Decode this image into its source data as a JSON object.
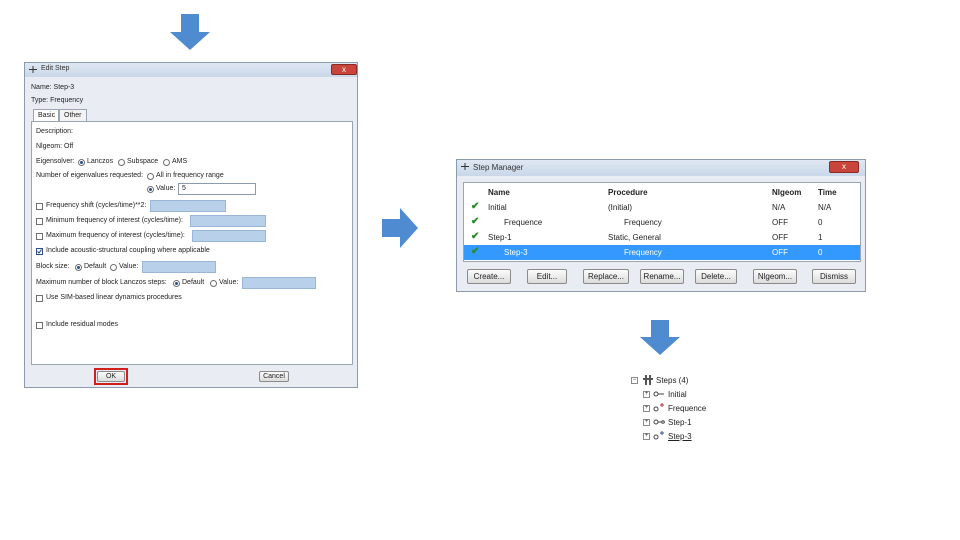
{
  "edit_step": {
    "title": "Edit Step",
    "close": "x",
    "name_line": "Name: Step-3",
    "type_line": "Type: Frequency",
    "tabs": [
      "Basic",
      "Other"
    ],
    "description": "Description:",
    "nlgeom": "Nlgeom: Off",
    "eigensolver_label": "Eigensolver:",
    "eigensolver_options": [
      "Lanczos",
      "Subspace",
      "AMS"
    ],
    "num_eigen_label": "Number of eigenvalues requested:",
    "num_eigen_option_all": "All in frequency range",
    "num_eigen_option_value": "Value:",
    "num_eigen_value": "5",
    "freq_shift": "Frequency shift (cycles/time)**2:",
    "min_freq": "Minimum frequency of interest (cycles/time):",
    "max_freq": "Maximum frequency of interest (cycles/time):",
    "acoustic": "Include acoustic-structural coupling where applicable",
    "block_size_label": "Block size:",
    "block_size_options": [
      "Default",
      "Value:"
    ],
    "max_blocks_label": "Maximum number of block Lanczos steps:",
    "max_blocks_options": [
      "Default",
      "Value:"
    ],
    "sim_label": "Use SIM-based linear dynamics procedures",
    "residual_label": "Include residual modes",
    "ok": "OK",
    "cancel": "Cancel"
  },
  "step_manager": {
    "title": "Step Manager",
    "close": "x",
    "headers": [
      "Name",
      "Procedure",
      "Nlgeom",
      "Time"
    ],
    "rows": [
      {
        "name": "Initial",
        "procedure": "(Initial)",
        "nlgeom": "N/A",
        "time": "N/A"
      },
      {
        "name": "Frequence",
        "procedure": "Frequency",
        "nlgeom": "OFF",
        "time": "0"
      },
      {
        "name": "Step-1",
        "procedure": "Static, General",
        "nlgeom": "OFF",
        "time": "1"
      },
      {
        "name": "Step-3",
        "procedure": "Frequency",
        "nlgeom": "OFF",
        "time": "0"
      }
    ],
    "buttons": [
      "Create...",
      "Edit...",
      "Replace...",
      "Rename...",
      "Delete...",
      "Nlgeom...",
      "Dismiss"
    ]
  },
  "tree": {
    "root": "Steps (4)",
    "children": [
      "Initial",
      "Frequence",
      "Step-1",
      "Step-3"
    ]
  },
  "colors": {
    "arrow": "#4f8bd0",
    "selection": "#3399ff",
    "ok_highlight": "#d0201c"
  }
}
